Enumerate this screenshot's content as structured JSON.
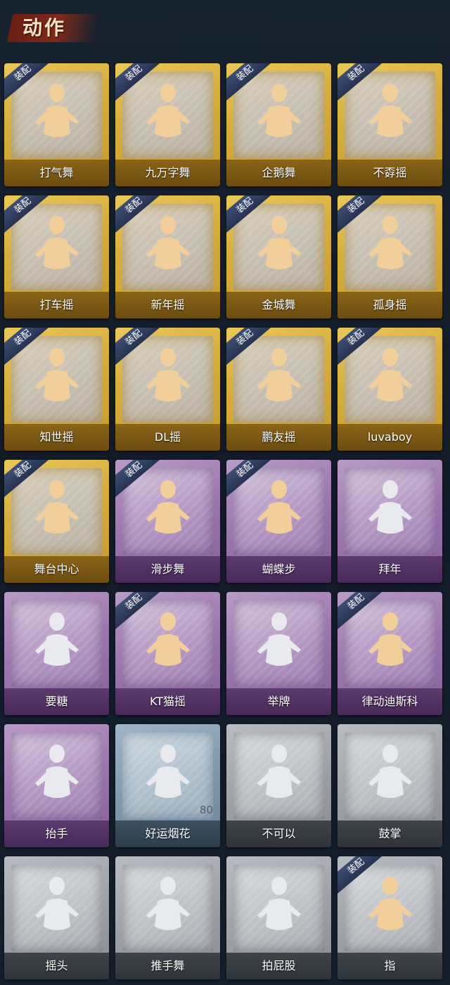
{
  "header": {
    "title": "动作"
  },
  "equipped_label": "装配",
  "colors": {
    "gold": "#d7ad3b",
    "purple": "#9a74ad",
    "blue": "#7f98ab",
    "gray": "#9ca1a6",
    "silhouette_gold": "#f2cf9a",
    "silhouette_pale": "#e8eaee"
  },
  "items": [
    {
      "label": "打气舞",
      "rarity": "gold",
      "equipped": true,
      "icon": "dance-figure-icon"
    },
    {
      "label": "九万字舞",
      "rarity": "gold",
      "equipped": true,
      "icon": "dance-figure-icon"
    },
    {
      "label": "企鹅舞",
      "rarity": "gold",
      "equipped": true,
      "icon": "dance-figure-icon"
    },
    {
      "label": "不孬摇",
      "rarity": "gold",
      "equipped": true,
      "icon": "dance-figure-icon"
    },
    {
      "label": "打车摇",
      "rarity": "gold",
      "equipped": true,
      "icon": "dance-figure-icon"
    },
    {
      "label": "新年摇",
      "rarity": "gold",
      "equipped": true,
      "icon": "dance-figure-icon"
    },
    {
      "label": "金城舞",
      "rarity": "gold",
      "equipped": true,
      "icon": "dance-figure-icon"
    },
    {
      "label": "孤身摇",
      "rarity": "gold",
      "equipped": true,
      "icon": "dance-figure-icon"
    },
    {
      "label": "知世摇",
      "rarity": "gold",
      "equipped": true,
      "icon": "dance-figure-icon"
    },
    {
      "label": "DL摇",
      "rarity": "gold",
      "equipped": true,
      "icon": "dance-figure-icon"
    },
    {
      "label": "鹏友摇",
      "rarity": "gold",
      "equipped": true,
      "icon": "dance-figure-icon"
    },
    {
      "label": "luvaboy",
      "rarity": "gold",
      "equipped": true,
      "icon": "dance-figure-icon"
    },
    {
      "label": "舞台中心",
      "rarity": "gold",
      "equipped": true,
      "icon": "dance-figure-icon"
    },
    {
      "label": "滑步舞",
      "rarity": "purple",
      "equipped": true,
      "icon": "dance-figure-icon"
    },
    {
      "label": "蝴蝶步",
      "rarity": "purple",
      "equipped": true,
      "icon": "dance-figure-icon"
    },
    {
      "label": "拜年",
      "rarity": "purple",
      "equipped": false,
      "icon": "bow-figure-icon"
    },
    {
      "label": "要糖",
      "rarity": "purple",
      "equipped": false,
      "icon": "beg-figure-icon"
    },
    {
      "label": "KT猫摇",
      "rarity": "purple",
      "equipped": true,
      "icon": "dance-figure-icon"
    },
    {
      "label": "举牌",
      "rarity": "purple",
      "equipped": false,
      "icon": "sign-figure-icon"
    },
    {
      "label": "律动迪斯科",
      "rarity": "purple",
      "equipped": true,
      "icon": "disco-figure-icon"
    },
    {
      "label": "抬手",
      "rarity": "purple",
      "equipped": false,
      "icon": "raise-hand-icon"
    },
    {
      "label": "好运烟花",
      "rarity": "blue",
      "equipped": false,
      "icon": "firework-icon",
      "count": "80"
    },
    {
      "label": "不可以",
      "rarity": "gray",
      "equipped": false,
      "icon": "finger-wag-icon"
    },
    {
      "label": "鼓掌",
      "rarity": "gray",
      "equipped": false,
      "icon": "clap-hands-icon"
    },
    {
      "label": "摇头",
      "rarity": "gray",
      "equipped": false,
      "icon": "shake-head-icon"
    },
    {
      "label": "推手舞",
      "rarity": "gray",
      "equipped": false,
      "icon": "push-hands-icon"
    },
    {
      "label": "拍屁股",
      "rarity": "gray",
      "equipped": false,
      "icon": "pat-figure-icon"
    },
    {
      "label": "指",
      "rarity": "gray",
      "equipped": true,
      "icon": "point-hand-icon"
    }
  ]
}
